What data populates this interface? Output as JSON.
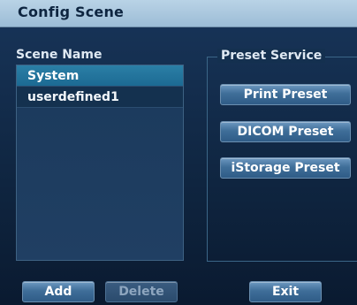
{
  "window": {
    "title": "Config Scene"
  },
  "scene_panel": {
    "label": "Scene Name",
    "items": [
      {
        "label": "System",
        "selected": true
      },
      {
        "label": "userdefined1",
        "selected": false
      }
    ]
  },
  "preset_service": {
    "legend": "Preset Service",
    "buttons": [
      {
        "label": "Print Preset"
      },
      {
        "label": "DICOM Preset"
      },
      {
        "label": "iStorage Preset"
      }
    ]
  },
  "footer": {
    "add_label": "Add",
    "delete_label": "Delete",
    "exit_label": "Exit",
    "delete_enabled": false
  },
  "colors": {
    "title_bar": "#a9c7de",
    "selected_item": "#2478a0",
    "panel_bg": "#1b3a5c",
    "button": "#3f6e99"
  }
}
